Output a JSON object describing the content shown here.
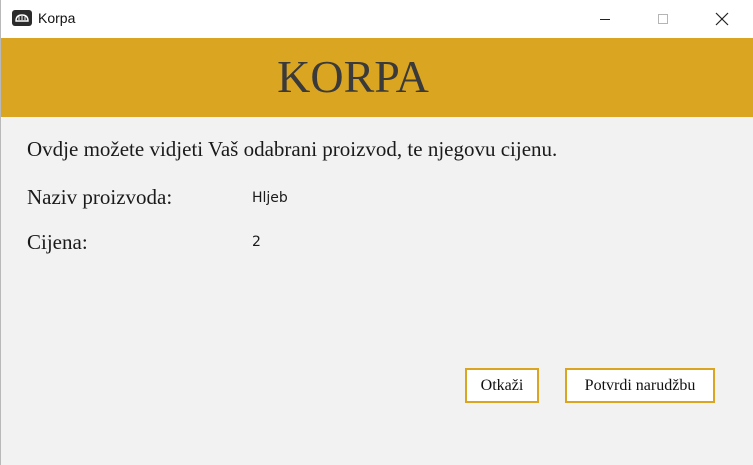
{
  "window": {
    "title": "Korpa",
    "app_icon": "bread-icon",
    "controls": [
      "minimize-icon",
      "maximize-icon",
      "close-icon"
    ]
  },
  "header": {
    "title": "KORPA",
    "background": "#daa520"
  },
  "content": {
    "intro": "Ovdje možete vidjeti Vaš odabrani proizvod, te njegovu cijenu.",
    "product_label": "Naziv proizvoda:",
    "product_value": "Hljeb",
    "price_label": "Cijena:",
    "price_value": "2"
  },
  "actions": {
    "cancel_label": "Otkaži",
    "confirm_label": "Potvrdi narudžbu"
  },
  "colors": {
    "accent": "#daa520",
    "background": "#f2f2f2"
  }
}
